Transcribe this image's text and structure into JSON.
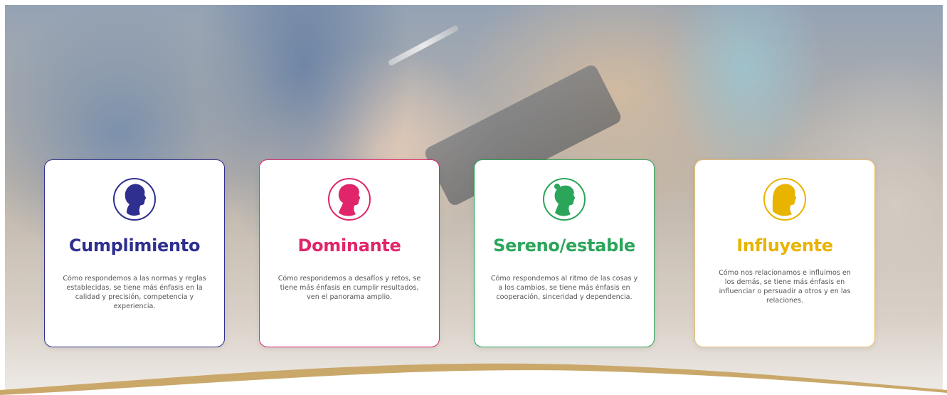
{
  "colors": {
    "cumplimiento": "#2e2f8f",
    "dominante": "#e0256a",
    "sereno": "#2ba55a",
    "influyente": "#e8b400",
    "wave": "#c9a86a"
  },
  "cards": [
    {
      "title": "Cumplimiento",
      "icon": "profile-head-icon",
      "description": "Cómo respondemos a las normas y reglas establecidas, se tiene más énfasis en la calidad y precisión, competencia y experiencia."
    },
    {
      "title": "Dominante",
      "icon": "profile-head-icon",
      "description": "Cómo respondemos a desafíos y retos, se tiene más énfasis en cumplir resultados, ven el panorama amplio."
    },
    {
      "title": "Sereno/estable",
      "icon": "profile-head-icon",
      "description": "Cómo respondemos al ritmo de las cosas y a los cambios, se tiene más énfasis en cooperación, sinceridad y dependencia."
    },
    {
      "title": "Influyente",
      "icon": "profile-head-icon",
      "description": "Cómo nos relacionamos e influimos en los demás, se tiene más énfasis en influenciar o persuadir a otros y en las relaciones."
    }
  ]
}
